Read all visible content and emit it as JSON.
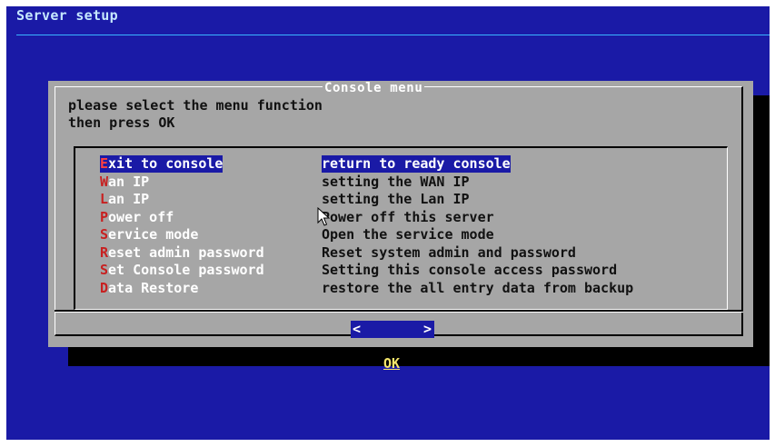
{
  "backtitle": "Server setup",
  "dialog": {
    "title": "Console menu",
    "prompt_line1": "please select the menu function",
    "prompt_line2": "then press OK"
  },
  "menu": {
    "items": [
      {
        "hot": "E",
        "rest": "xit to console",
        "desc": "return to ready console",
        "selected": true
      },
      {
        "hot": "W",
        "rest": "an IP",
        "desc": "setting the WAN IP",
        "selected": false
      },
      {
        "hot": "L",
        "rest": "an IP",
        "desc": "setting the Lan IP",
        "selected": false
      },
      {
        "hot": "P",
        "rest": "ower off",
        "desc": "Power off this server",
        "selected": false
      },
      {
        "hot": "S",
        "rest": "ervice mode",
        "desc": "Open the service mode",
        "selected": false
      },
      {
        "hot": "R",
        "rest": "eset admin password",
        "desc": "Reset system admin and password",
        "selected": false
      },
      {
        "hot": "S",
        "rest": "et Console password",
        "desc": "Setting this console access password",
        "selected": false
      },
      {
        "hot": "D",
        "rest": "ata Restore",
        "desc": "restore the all entry data from backup",
        "selected": false
      }
    ]
  },
  "buttons": {
    "ok_left": "<",
    "ok_label": "OK",
    "ok_right": ">"
  },
  "colors": {
    "background": "#1a1aa6",
    "dialog": "#a6a6a6",
    "hotkey": "#c82020",
    "button_label": "#f5e66b"
  },
  "icons": {
    "cursor": "mouse-pointer-icon"
  }
}
